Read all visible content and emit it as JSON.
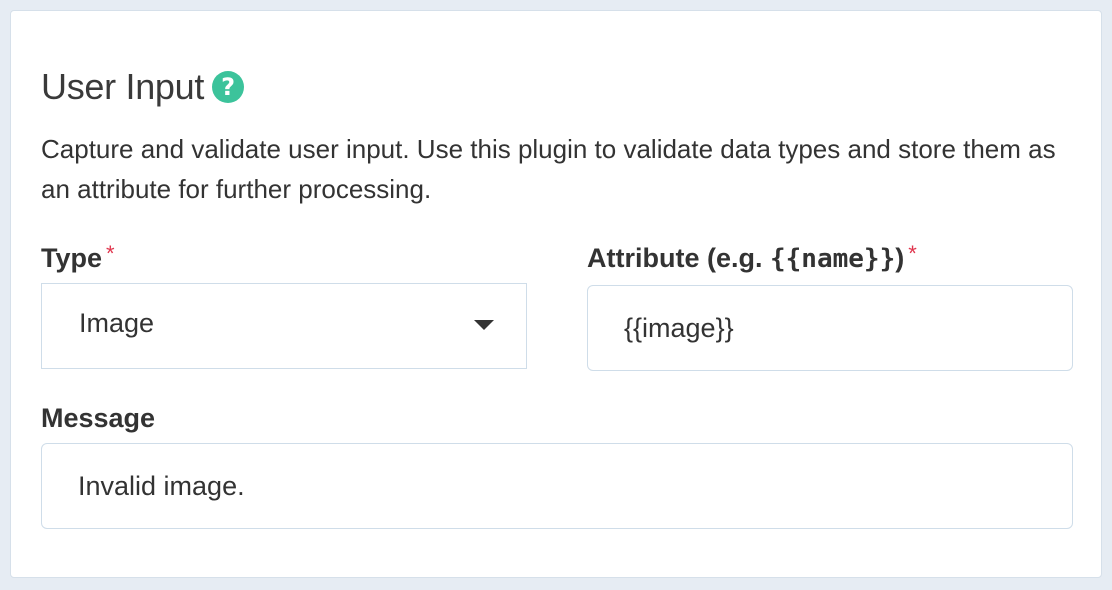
{
  "plugin": {
    "title": "User Input",
    "help_icon": "question-circle-icon",
    "description": "Capture and validate user input. Use this plugin to validate data types and store them as an attribute for further processing."
  },
  "fields": {
    "type": {
      "label": "Type",
      "required_mark": "*",
      "value": "Image",
      "caret_icon": "caret-down-icon"
    },
    "attribute": {
      "label_prefix": "Attribute (e.g. ",
      "label_code": "{{name}}",
      "label_suffix": ")",
      "required_mark": "*",
      "value": "{{image}}"
    },
    "message": {
      "label": "Message",
      "value": "Invalid image."
    }
  },
  "colors": {
    "accent": "#3cc39b",
    "required": "#e0354d",
    "border": "#cfdde9",
    "background": "#e6ecf3"
  }
}
